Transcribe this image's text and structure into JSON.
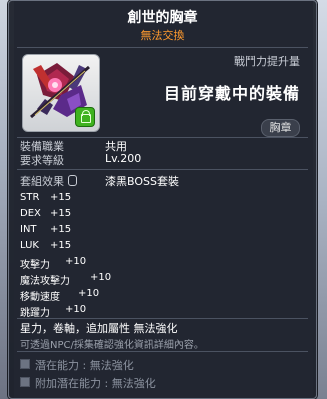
{
  "item": {
    "name": "創世的胸章",
    "trade_status": "無法交換",
    "power_label": "戰鬥力提升量",
    "equipped_text": "目前穿戴中的裝備",
    "slot": "胸章"
  },
  "requirements": [
    {
      "label": "裝備職業",
      "value": "共用"
    },
    {
      "label": "要求等級",
      "value": "Lv.200"
    }
  ],
  "set_effect": {
    "label": "套組效果",
    "value": "漆黑BOSS套裝"
  },
  "stats": [
    {
      "label": "STR",
      "value": "+15"
    },
    {
      "label": "DEX",
      "value": "+15"
    },
    {
      "label": "INT",
      "value": "+15"
    },
    {
      "label": "LUK",
      "value": "+15"
    },
    {
      "label": "攻擊力",
      "value": "+10"
    },
    {
      "label": "魔法攻擊力",
      "value": "+10"
    },
    {
      "label": "移動速度",
      "value": "+10"
    },
    {
      "label": "跳躍力",
      "value": "+10"
    }
  ],
  "notes": {
    "restrictions": "星力，卷軸，追加屬性 無法強化",
    "info": "可透過NPC/採集確認強化資訊詳細內容。"
  },
  "potentials": [
    {
      "text": "潛在能力 : 無法強化"
    },
    {
      "text": "附加潛在能力 : 無法強化"
    }
  ],
  "colors": {
    "trade_status": "#ff9a2e",
    "panel_bg": "#1a1e28",
    "lock_badge": "#3fb21f"
  },
  "icons": {
    "item": "chest-emblem-icon",
    "lock": "lock-icon",
    "set_clip": "clip-icon",
    "potential": "potential-icon"
  }
}
